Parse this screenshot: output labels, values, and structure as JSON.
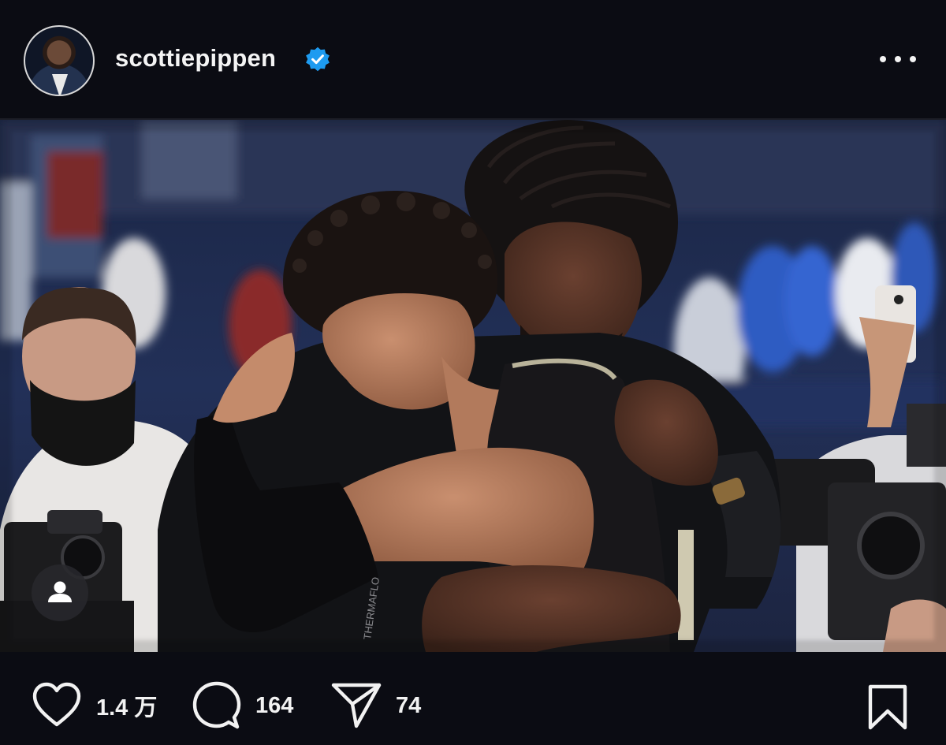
{
  "post": {
    "username": "scottiepippen",
    "verified": true,
    "accent_color": "#1d9bf0"
  },
  "actions": {
    "likes": "1.4 万",
    "comments": "164",
    "shares": "74"
  },
  "icons": {
    "avatar": "profile-avatar",
    "verified": "verified-badge-icon",
    "more": "more-dots-icon",
    "user_tag": "user-tag-icon",
    "like": "heart-icon",
    "comment": "comment-bubble-icon",
    "share": "paper-plane-icon",
    "save": "bookmark-icon"
  },
  "photo_text": {
    "sleeve_print": "THERMAFLO"
  }
}
